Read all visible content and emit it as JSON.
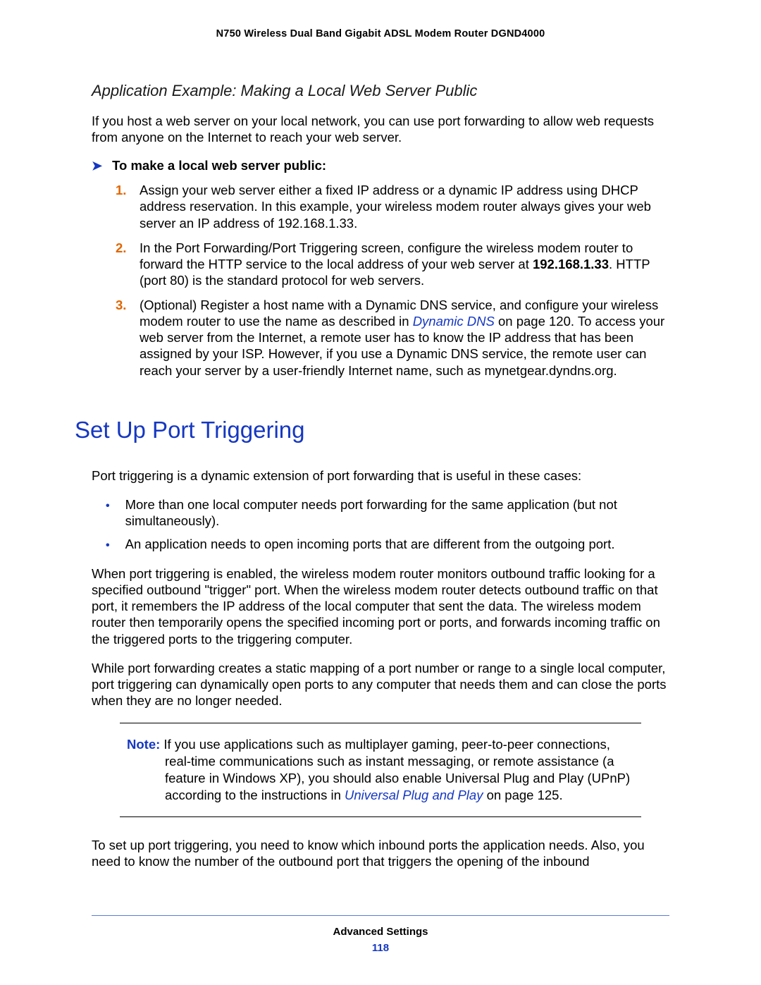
{
  "header": {
    "title": "N750 Wireless Dual Band Gigabit ADSL Modem Router DGND4000"
  },
  "section1": {
    "heading": "Application Example: Making a Local Web Server Public",
    "intro": "If you host a web server on your local network, you can use port forwarding to allow web requests from anyone on the Internet to reach your web server.",
    "procedure_heading": "To make a local web server public:",
    "step1": "Assign your web server either a fixed IP address or a dynamic IP address using DHCP address reservation. In this example, your wireless modem router always gives your web server an IP address of 192.168.1.33.",
    "step2_a": "In the Port Forwarding/Port Triggering screen, configure the wireless modem router to forward the HTTP service to the local address of your web server at ",
    "step2_ip": "192.168.1.33",
    "step2_b": ". HTTP (port 80) is the standard protocol for web servers.",
    "step3_a": "(Optional) Register a host name with a Dynamic DNS service, and configure your wireless modem router to use the name as described in ",
    "step3_link": "Dynamic DNS",
    "step3_b": " on page 120. To access your web server from the Internet, a remote user has to know the IP address that has been assigned by your ISP. However, if you use a Dynamic DNS service, the remote user can reach your server by a user-friendly Internet name, such as mynetgear.dyndns.org."
  },
  "section2": {
    "heading": "Set Up Port Triggering",
    "intro": "Port triggering is a dynamic extension of port forwarding that is useful in these cases:",
    "bullet1": "More than one local computer needs port forwarding for the same application (but not simultaneously).",
    "bullet2": "An application needs to open incoming ports that are different from the outgoing port.",
    "para2": "When port triggering is enabled, the wireless modem router monitors outbound traffic looking for a specified outbound \"trigger\" port. When the wireless modem router detects outbound traffic on that port, it remembers the IP address of the local computer that sent the data. The wireless modem router then temporarily opens the specified incoming port or ports, and forwards incoming traffic on the triggered ports to the triggering computer.",
    "para3": "While port forwarding creates a static mapping of a port number or range to a single local computer, port triggering can dynamically open ports to any computer that needs them and can close the ports when they are no longer needed.",
    "note_label": "Note:",
    "note_a": " If you use applications such as multiplayer gaming, peer-to-peer connections, real-time communications such as instant messaging, or remote assistance (a feature in Windows XP), you should also enable Universal Plug and Play (UPnP) according to the instructions in ",
    "note_link": "Universal Plug and Play",
    "note_b": " on page 125.",
    "para4": "To set up port triggering, you need to know which inbound ports the application needs. Also, you need to know the number of the outbound port that triggers the opening of the inbound"
  },
  "footer": {
    "title": "Advanced Settings",
    "page": "118"
  }
}
